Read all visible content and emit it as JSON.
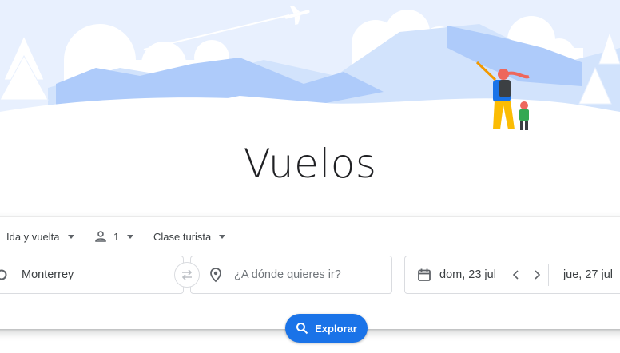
{
  "title": "Vuelos",
  "options": {
    "trip_type": "Ida y vuelta",
    "passengers": "1",
    "cabin_class": "Clase turista"
  },
  "search": {
    "origin": "Monterrey",
    "destination_placeholder": "¿A dónde quieres ir?",
    "departure_date": "dom, 23 jul",
    "return_date": "jue, 27 jul"
  },
  "explore_button": "Explorar",
  "colors": {
    "accent": "#1a73e8",
    "sky": "#e8f0fe",
    "mountain_light": "#d2e3fc",
    "mountain_mid": "#aecbfa"
  },
  "icons": [
    "airplane-icon",
    "person-icon",
    "swap-icon",
    "location-pin-icon",
    "calendar-icon",
    "chevron-left-icon",
    "chevron-right-icon",
    "search-icon"
  ]
}
